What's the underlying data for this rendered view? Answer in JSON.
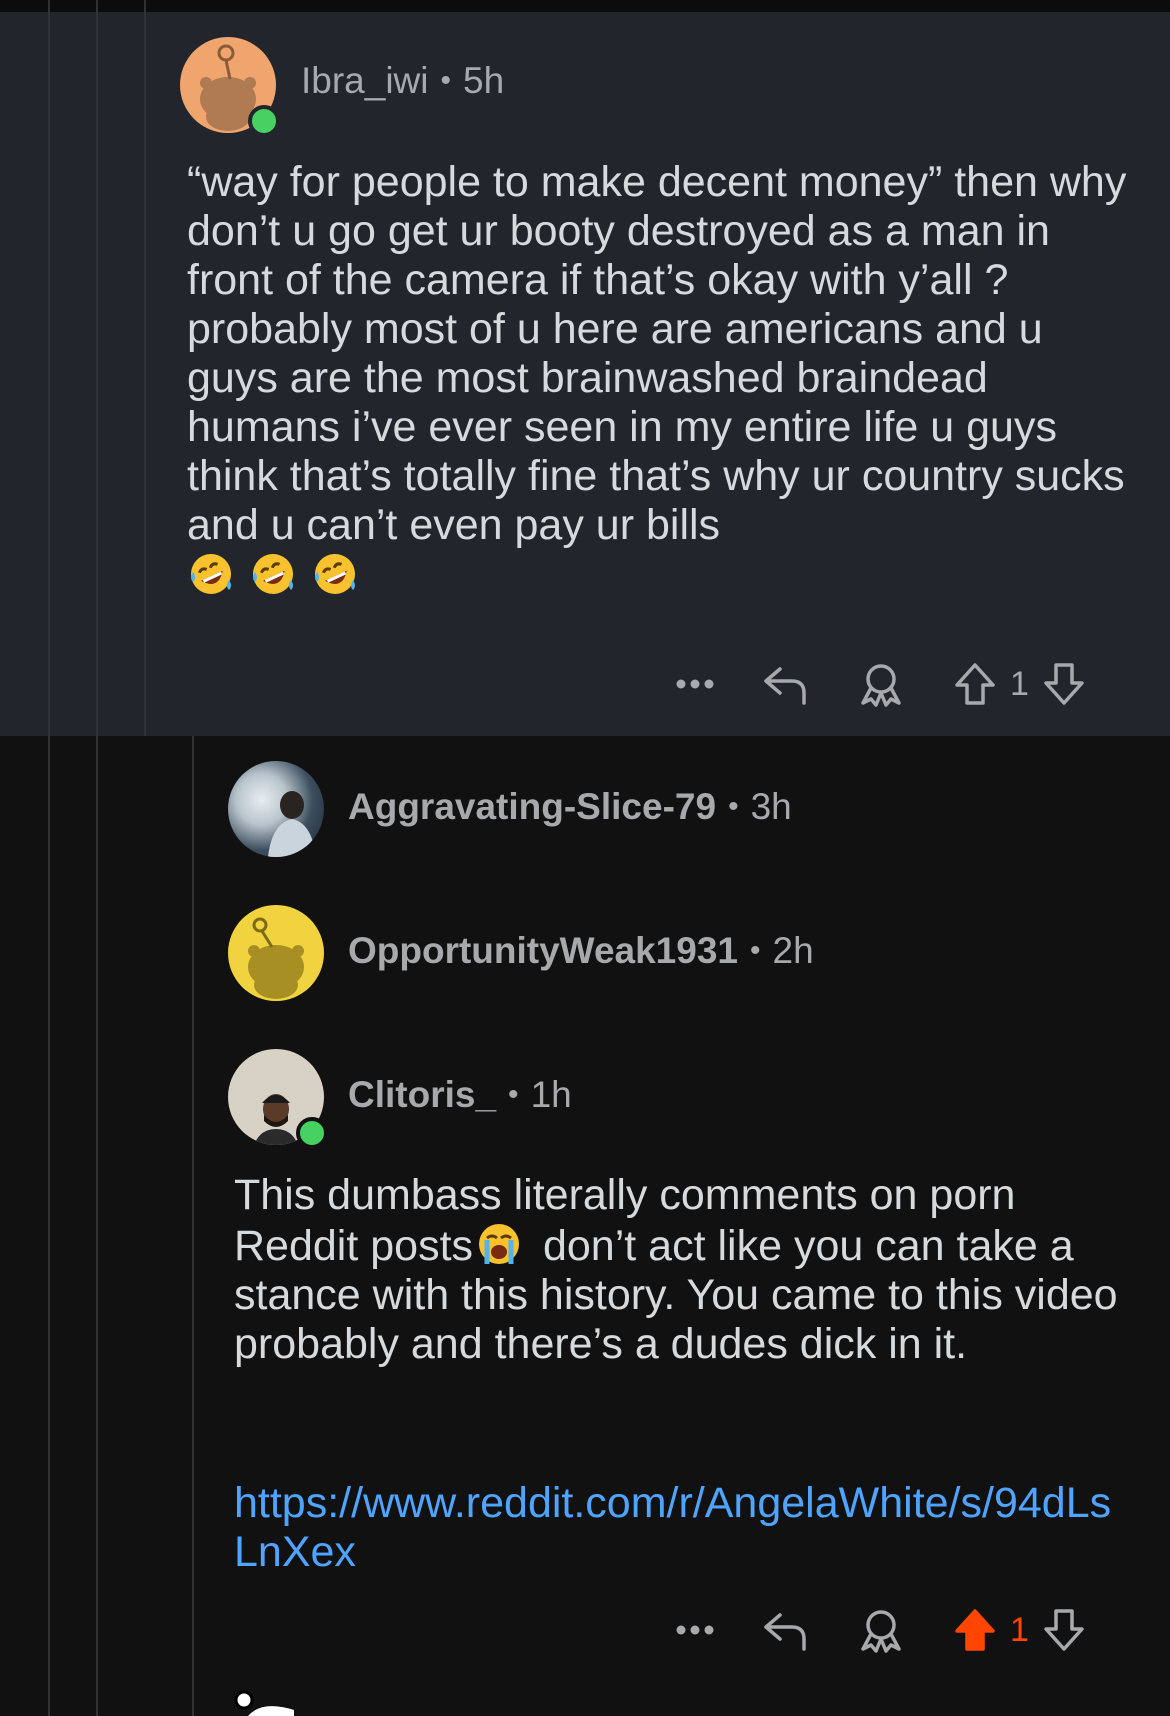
{
  "comments": [
    {
      "username": "Ibra_iwi",
      "time": "5h",
      "online": true,
      "text": "“way for people to make decent money” then why don’t u go get ur booty destroyed as a man in front of the camera if that’s okay with y’all ? probably most of u here are americans and u guys are the most brainwashed braindead humans i’ve ever seen in my entire life u guys think that’s totally fine that’s why ur country sucks and u can’t even pay ur bills",
      "emoji": [
        "rolling-on-floor-laughing",
        "rolling-on-floor-laughing",
        "rolling-on-floor-laughing"
      ],
      "votes": "1",
      "upvoted": false
    },
    {
      "username": "Aggravating-Slice-79",
      "time": "3h",
      "collapsed": true
    },
    {
      "username": "OpportunityWeak1931",
      "time": "2h",
      "collapsed": true
    },
    {
      "username": "Clitoris_",
      "time": "1h",
      "online": true,
      "text_before_emoji": "This dumbass literally comments on porn Reddit posts",
      "emoji": "loudly-crying-face",
      "text_after_emoji": " don’t act like you can take a stance with this history. You came to this video probably and there’s a dudes dick in it.",
      "link": "https://www.reddit.com/r/AngelaWhite/s/94dLsLnXex",
      "votes": "1",
      "upvoted": true
    }
  ],
  "icons": {
    "more": "more-icon",
    "reply": "reply-icon",
    "award": "award-icon",
    "upvote": "upvote-arrow-icon",
    "downvote": "downvote-arrow-icon"
  },
  "colors": {
    "highlight_bg": "#22262c",
    "background": "#111112",
    "upvote": "#ff4500",
    "link": "#4fa4ff",
    "online": "#46d160"
  }
}
